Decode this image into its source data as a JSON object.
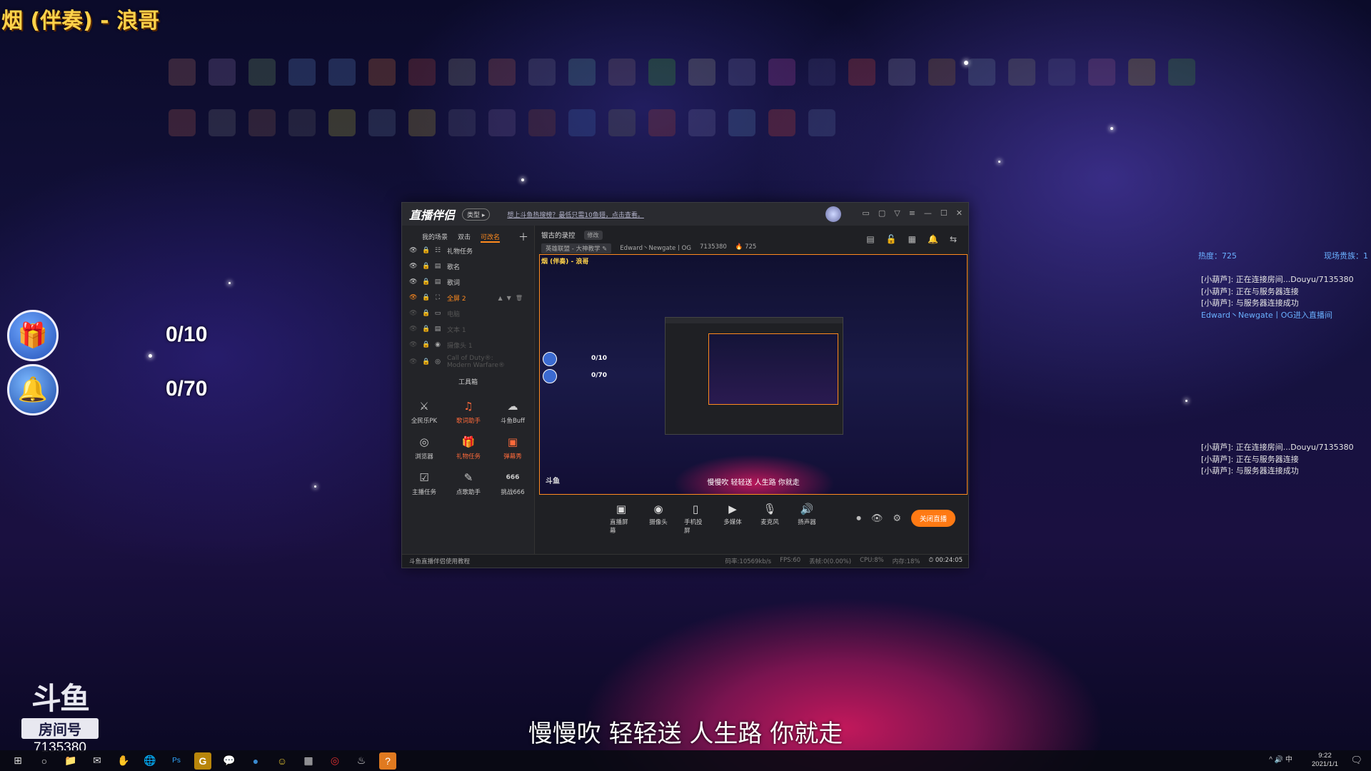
{
  "overlay": {
    "song_title": "烟 (伴奏) - 浪哥",
    "gift_counts": [
      "0/10",
      "0/70"
    ],
    "lyric": "慢慢吹 轻轻送 人生路 你就走",
    "logo_mark": "斗鱼",
    "logo_room_label": "房间号",
    "room_number": "7135380"
  },
  "side_panel": {
    "heat_label": "热度：725",
    "gifts_label": "现场贵族：1",
    "chat_top": [
      {
        "text": "[小葫芦]: 正在连接房间...Douyu/7135380",
        "highlight": false
      },
      {
        "text": "[小葫芦]: 正在与服务器连接",
        "highlight": false
      },
      {
        "text": "[小葫芦]: 与服务器连接成功",
        "highlight": false
      },
      {
        "text": "Edward丶Newgate丨OG进入直播间",
        "highlight": true
      }
    ],
    "chat_bottom": [
      {
        "text": "[小葫芦]: 正在连接房间...Douyu/7135380"
      },
      {
        "text": "[小葫芦]: 正在与服务器连接"
      },
      {
        "text": "[小葫芦]: 与服务器连接成功"
      }
    ]
  },
  "app": {
    "title": "直播伴侣",
    "type_pill": "类型 ▸",
    "notice": "想上斗鱼热搜榜？最低只需10鱼翅，点击查看。",
    "window_controls": [
      "▭",
      "▢",
      "▽",
      "≡",
      "—",
      "☐",
      "✕"
    ],
    "scene_tabs": [
      "我的场景",
      "双击",
      "可改名"
    ],
    "scene_active_index": 2,
    "sources": [
      {
        "name": "礼物任务",
        "kind": "☷",
        "state": "normal"
      },
      {
        "name": "歌名",
        "kind": "▤",
        "state": "normal"
      },
      {
        "name": "歌词",
        "kind": "▤",
        "state": "normal"
      },
      {
        "name": "全屏 2",
        "kind": "⛶",
        "state": "selected"
      },
      {
        "name": "电脑",
        "kind": "▭",
        "state": "dim"
      },
      {
        "name": "文本 1",
        "kind": "▤",
        "state": "dim"
      },
      {
        "name": "摄像头 1",
        "kind": "◉",
        "state": "dim"
      },
      {
        "name": "Call of Duty®: Modern Warfare®",
        "kind": "◎",
        "state": "dim"
      }
    ],
    "toolbox_title": "工具箱",
    "tools": [
      {
        "label": "全民乐PK",
        "icon": "⚔",
        "orange": false
      },
      {
        "label": "歌词助手",
        "icon": "♫",
        "orange": true
      },
      {
        "label": "斗鱼Buff",
        "icon": "☁",
        "orange": false
      },
      {
        "label": "浏览器",
        "icon": "◎",
        "orange": false
      },
      {
        "label": "礼物任务",
        "icon": "🎁",
        "orange": true
      },
      {
        "label": "弹幕秀",
        "icon": "▣",
        "orange": true
      },
      {
        "label": "主播任务",
        "icon": "☑",
        "orange": false
      },
      {
        "label": "点歌助手",
        "icon": "✎",
        "orange": false
      },
      {
        "label": "挑战666",
        "icon": "666",
        "orange": false
      }
    ],
    "stream_name": "银古的录控",
    "edit_label": "修改",
    "category": "英雄联盟 - 大神教学 ✎",
    "streamer": "Edward丶Newgate丨OG",
    "room_id": "7135380",
    "heat": "🔥 725",
    "preview_icons": [
      "▤",
      "🔓",
      "▦",
      "🔔",
      "⇆"
    ],
    "preview": {
      "song_title": "烟 (伴奏) - 浪哥",
      "counts": [
        "0/10",
        "0/70"
      ],
      "lyric": "慢慢吹 轻轻送 人生路 你就走",
      "logo": "斗鱼"
    },
    "controls": [
      {
        "label": "直播屏幕",
        "icon": "▣"
      },
      {
        "label": "摄像头",
        "icon": "◉"
      },
      {
        "label": "手机投屏",
        "icon": "▯"
      },
      {
        "label": "多媒体",
        "icon": "▶"
      },
      {
        "label": "麦克风",
        "icon": "🎙"
      },
      {
        "label": "扬声器",
        "icon": "🔊"
      }
    ],
    "live_button": "关闭直播",
    "tutorial": "斗鱼直播伴侣使用教程",
    "stats": {
      "bitrate": "码率:10569kb/s",
      "fps": "FPS:60",
      "dropped": "丢帧:0(0.00%)",
      "cpu": "CPU:8%",
      "memory": "内存:18%",
      "timer": "⏱ 00:24:05"
    }
  },
  "taskbar": {
    "icons": [
      "⊞",
      "○",
      "📁",
      "✉",
      "✋",
      "🌐",
      "Ps",
      "G",
      "💬",
      "●",
      "☺",
      "▦",
      "◎",
      "♨",
      "?"
    ],
    "tray": "^ 🔊 中",
    "time": "9:22",
    "date": "2021/1/1"
  }
}
